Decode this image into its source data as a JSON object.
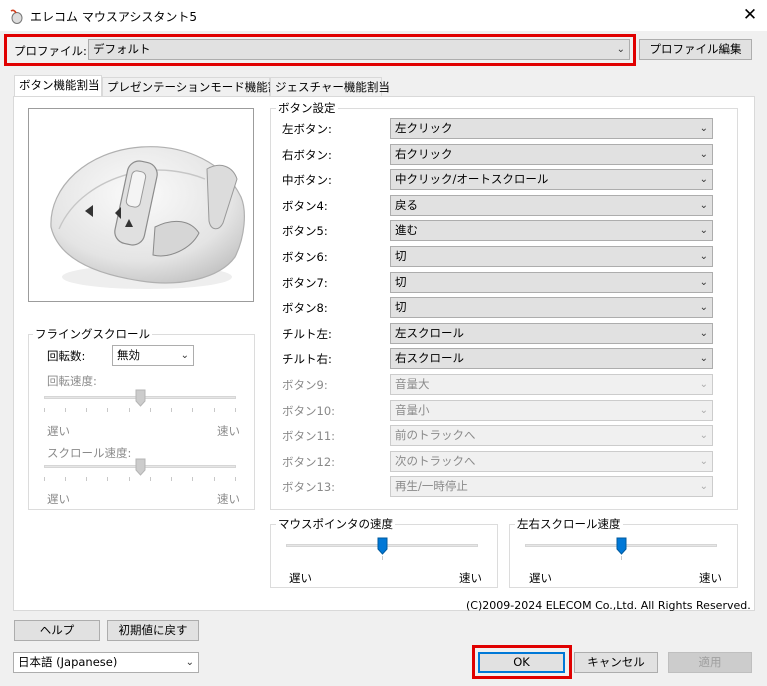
{
  "window": {
    "title": "エレコム マウスアシスタント5",
    "close_glyph": "✕",
    "app_icon": "mouse-app-icon"
  },
  "profile": {
    "label": "プロファイル:",
    "value": "デフォルト",
    "edit_button": "プロファイル編集"
  },
  "tabs": [
    {
      "label": "ボタン機能割当",
      "active": true
    },
    {
      "label": "プレゼンテーションモード機能割当",
      "active": false
    },
    {
      "label": "ジェスチャー機能割当",
      "active": false
    }
  ],
  "button_settings": {
    "group_label": "ボタン設定",
    "rows": [
      {
        "label": "左ボタン:",
        "value": "左クリック",
        "enabled": true
      },
      {
        "label": "右ボタン:",
        "value": "右クリック",
        "enabled": true
      },
      {
        "label": "中ボタン:",
        "value": "中クリック/オートスクロール",
        "enabled": true
      },
      {
        "label": "ボタン4:",
        "value": "戻る",
        "enabled": true
      },
      {
        "label": "ボタン5:",
        "value": "進む",
        "enabled": true
      },
      {
        "label": "ボタン6:",
        "value": "切",
        "enabled": true
      },
      {
        "label": "ボタン7:",
        "value": "切",
        "enabled": true
      },
      {
        "label": "ボタン8:",
        "value": "切",
        "enabled": true
      },
      {
        "label": "チルト左:",
        "value": "左スクロール",
        "enabled": true
      },
      {
        "label": "チルト右:",
        "value": "右スクロール",
        "enabled": true
      },
      {
        "label": "ボタン9:",
        "value": "音量大",
        "enabled": false
      },
      {
        "label": "ボタン10:",
        "value": "音量小",
        "enabled": false
      },
      {
        "label": "ボタン11:",
        "value": "前のトラックへ",
        "enabled": false
      },
      {
        "label": "ボタン12:",
        "value": "次のトラックへ",
        "enabled": false
      },
      {
        "label": "ボタン13:",
        "value": "再生/一時停止",
        "enabled": false
      }
    ]
  },
  "flying_scroll": {
    "group_label": "フライングスクロール",
    "rotation_label": "回転数:",
    "rotation_value": "無効",
    "rotation_speed_label": "回転速度:",
    "rotation_speed_slow": "遅い",
    "rotation_speed_fast": "速い",
    "scroll_speed_label": "スクロール速度:",
    "scroll_speed_slow": "遅い",
    "scroll_speed_fast": "速い",
    "rotation_speed_level": 0.5,
    "scroll_speed_level": 0.5
  },
  "pointer_speed": {
    "group_label": "マウスポインタの速度",
    "slow": "遅い",
    "fast": "速い",
    "level": 0.5
  },
  "hscroll_speed": {
    "group_label": "左右スクロール速度",
    "slow": "遅い",
    "fast": "速い",
    "level": 0.5
  },
  "copyright": "(C)2009-2024 ELECOM Co.,Ltd. All Rights Reserved.",
  "footer": {
    "help_button": "ヘルプ",
    "reset_button": "初期値に戻す",
    "language_value": "日本語 (Japanese)",
    "ok_button": "OK",
    "cancel_button": "キャンセル",
    "apply_button": "適用"
  },
  "colors": {
    "highlight": "#e00000",
    "accent": "#0078d7",
    "dropdown_arrow": "chevron-down-icon"
  }
}
